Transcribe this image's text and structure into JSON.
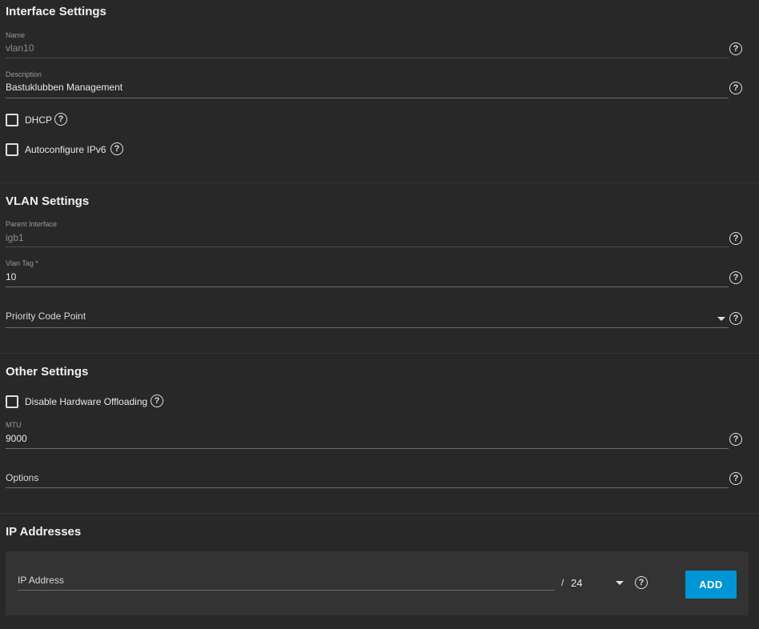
{
  "interface_settings": {
    "title": "Interface Settings",
    "name": {
      "label": "Name",
      "value": "vlan10"
    },
    "description": {
      "label": "Description",
      "value": "Bastuklubben Management"
    },
    "dhcp": {
      "label": "DHCP",
      "checked": false
    },
    "autoconfigure_ipv6": {
      "label": "Autoconfigure IPv6",
      "checked": false
    }
  },
  "vlan_settings": {
    "title": "VLAN Settings",
    "parent_interface": {
      "label": "Parent Interface",
      "value": "igb1"
    },
    "vlan_tag": {
      "label": "Vlan Tag *",
      "value": "10"
    },
    "priority_code_point": {
      "placeholder": "Priority Code Point"
    }
  },
  "other_settings": {
    "title": "Other Settings",
    "disable_hw_offloading": {
      "label": "Disable Hardware Offloading",
      "checked": false
    },
    "mtu": {
      "label": "MTU",
      "value": "9000"
    },
    "options": {
      "placeholder": "Options"
    }
  },
  "ip_addresses": {
    "title": "IP Addresses",
    "ip_address": {
      "placeholder": "IP Address"
    },
    "separator": "/",
    "netmask": "24",
    "add_label": "ADD"
  },
  "icons": {
    "help": "?",
    "dropdown": "caret-down"
  },
  "colors": {
    "background": "#282828",
    "panel": "#333333",
    "accent": "#0095d5"
  }
}
